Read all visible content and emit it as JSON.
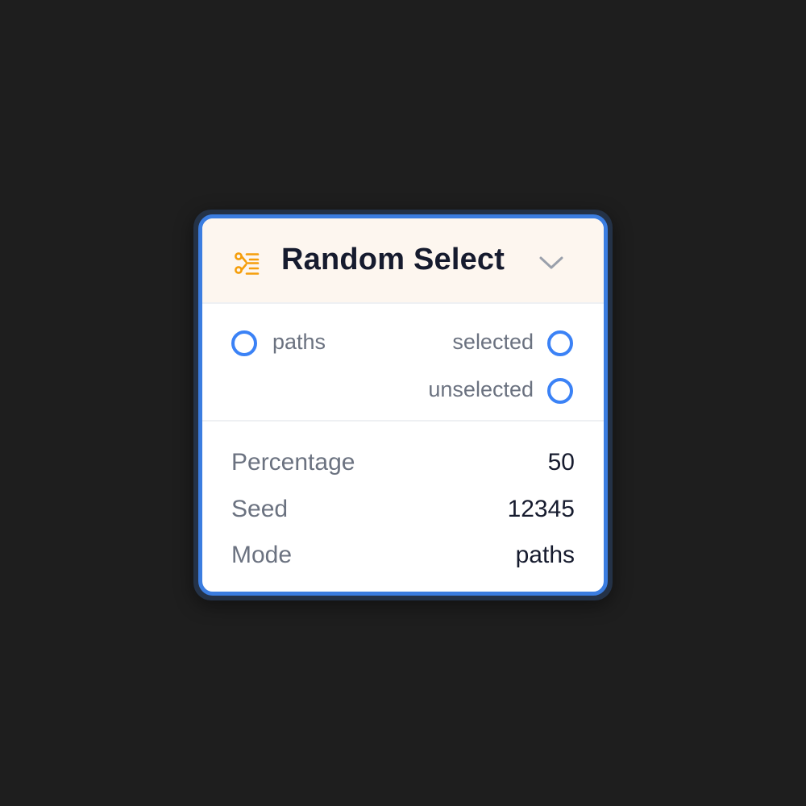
{
  "node": {
    "title": "Random Select",
    "icon": "branch-list-icon",
    "accent_color": "#3b7de0",
    "icon_color": "#f59e0b",
    "header_bg": "#fdf6ef"
  },
  "ports": {
    "inputs": [
      {
        "label": "paths"
      }
    ],
    "outputs": [
      {
        "label": "selected"
      },
      {
        "label": "unselected"
      }
    ],
    "port_color": "#3b82f6"
  },
  "params": [
    {
      "key": "Percentage",
      "value": "50"
    },
    {
      "key": "Seed",
      "value": "12345"
    },
    {
      "key": "Mode",
      "value": "paths"
    }
  ]
}
